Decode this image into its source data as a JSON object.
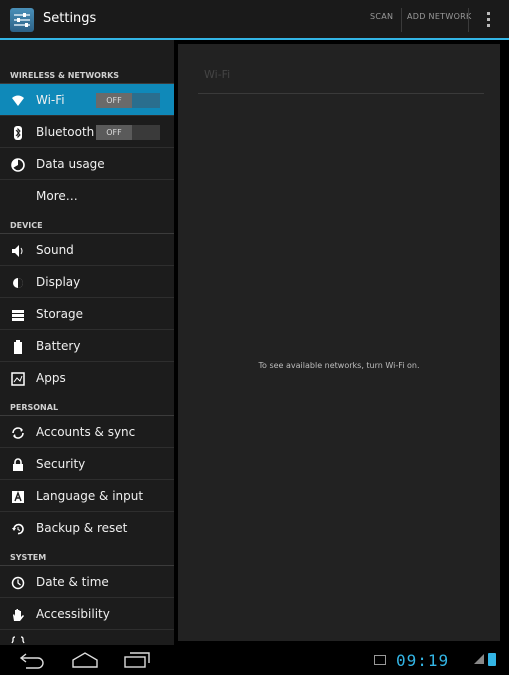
{
  "actionbar": {
    "title": "Settings",
    "scan": "SCAN",
    "add_network": "ADD NETWORK"
  },
  "sidebar": {
    "sections": {
      "wireless": "WIRELESS & NETWORKS",
      "device": "DEVICE",
      "personal": "PERSONAL",
      "system": "SYSTEM"
    },
    "items": {
      "wifi": {
        "label": "Wi-Fi",
        "toggle": "OFF"
      },
      "bluetooth": {
        "label": "Bluetooth",
        "toggle": "OFF"
      },
      "data_usage": "Data usage",
      "more": "More…",
      "sound": "Sound",
      "display": "Display",
      "storage": "Storage",
      "battery": "Battery",
      "apps": "Apps",
      "accounts": "Accounts & sync",
      "security": "Security",
      "language": "Language & input",
      "backup": "Backup & reset",
      "datetime": "Date & time",
      "accessibility": "Accessibility"
    }
  },
  "content": {
    "title": "Wi-Fi",
    "message": "To see available networks, turn Wi-Fi on."
  },
  "statusbar": {
    "time": "09:19"
  },
  "colors": {
    "accent": "#33b5e5",
    "selected": "#0f89b9"
  }
}
